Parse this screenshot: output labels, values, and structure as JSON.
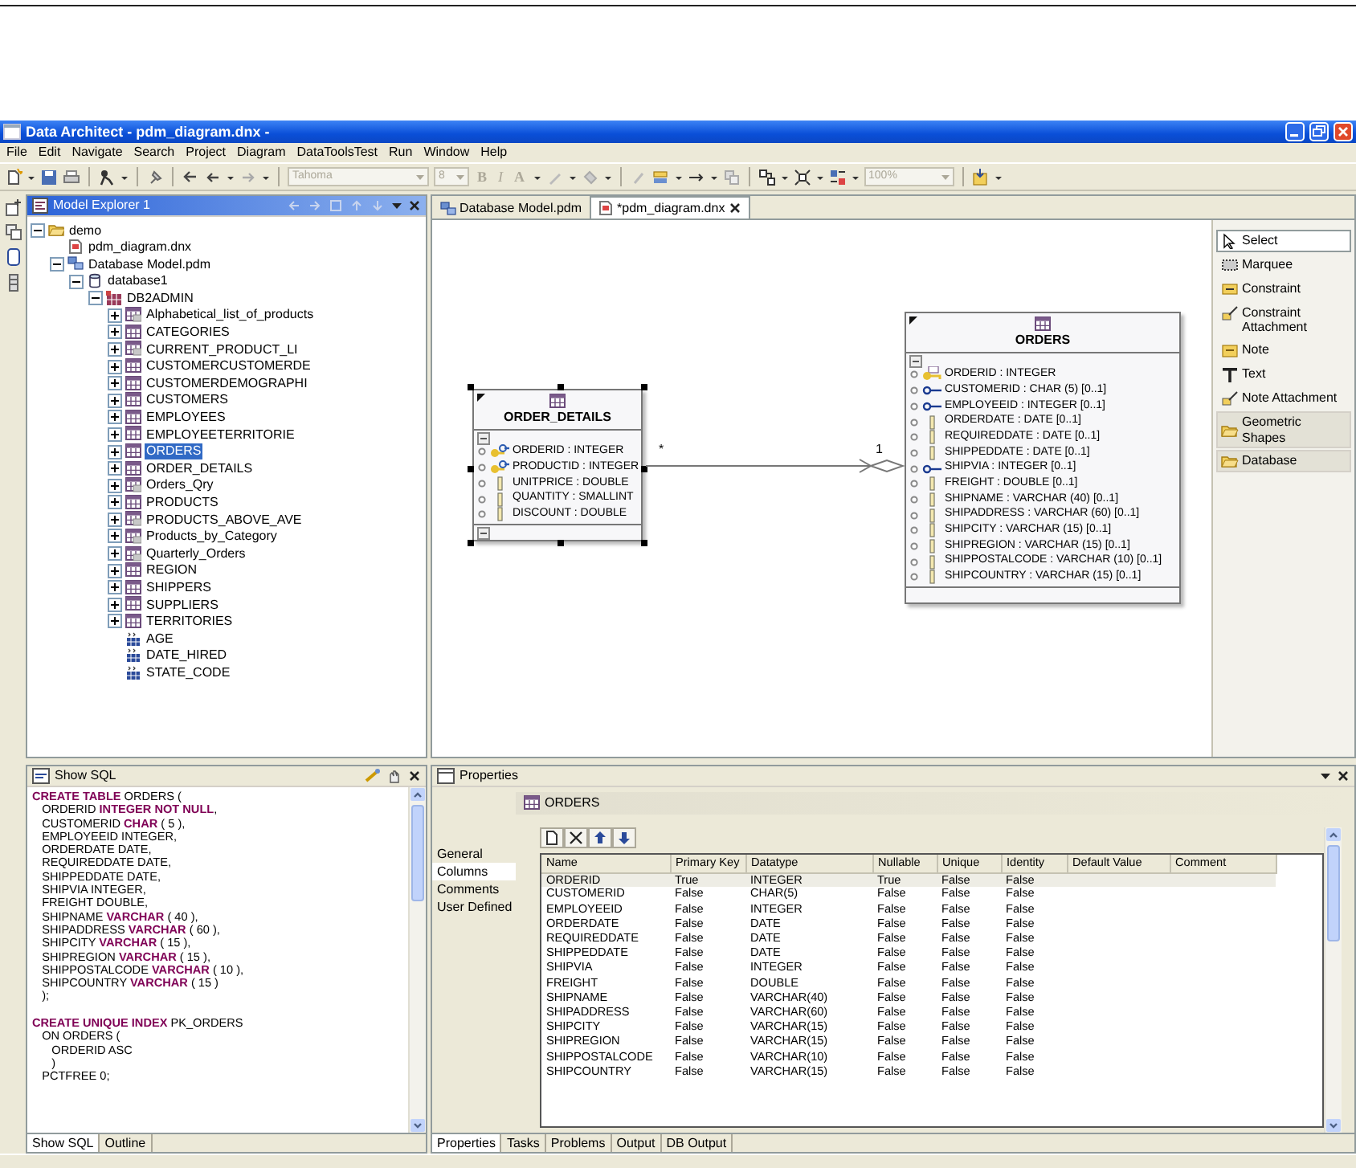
{
  "window": {
    "title": "Data Architect - pdm_diagram.dnx -"
  },
  "menu": [
    "File",
    "Edit",
    "Navigate",
    "Search",
    "Project",
    "Diagram",
    "DataToolsTest",
    "Run",
    "Window",
    "Help"
  ],
  "toolbar": {
    "font_field": {
      "value": "Tahoma",
      "disabled": true
    },
    "size_field": {
      "value": "8",
      "disabled": true
    },
    "glyph_buttons": [
      {
        "text": "B",
        "disabled": true
      },
      {
        "text": "I",
        "disabled": true
      },
      {
        "text": "A",
        "disabled": true
      }
    ],
    "zoom_field": {
      "value": "100%",
      "disabled": true
    }
  },
  "model_explorer": {
    "title": "Model Explorer 1",
    "tree": [
      {
        "label": "demo",
        "kind": "folder",
        "expanded": true,
        "selected": false,
        "children": [
          {
            "label": "pdm_diagram.dnx",
            "kind": "diagram",
            "selected": false
          },
          {
            "label": "Database Model.pdm",
            "kind": "model",
            "expanded": true,
            "selected": false,
            "children": [
              {
                "label": "database1",
                "kind": "database",
                "expanded": true,
                "selected": false,
                "children": [
                  {
                    "label": "DB2ADMIN",
                    "kind": "schema",
                    "expanded": true,
                    "selected": false,
                    "children": [
                      {
                        "label": "Alphabetical_list_of_products",
                        "kind": "view",
                        "expanded": false,
                        "selected": false
                      },
                      {
                        "label": "CATEGORIES",
                        "kind": "table",
                        "expanded": false,
                        "selected": false
                      },
                      {
                        "label": "CURRENT_PRODUCT_LI",
                        "kind": "view",
                        "expanded": false,
                        "selected": false
                      },
                      {
                        "label": "CUSTOMERCUSTOMERDE",
                        "kind": "table",
                        "expanded": false,
                        "selected": false
                      },
                      {
                        "label": "CUSTOMERDEMOGRAPHI",
                        "kind": "table",
                        "expanded": false,
                        "selected": false
                      },
                      {
                        "label": "CUSTOMERS",
                        "kind": "table",
                        "expanded": false,
                        "selected": false
                      },
                      {
                        "label": "EMPLOYEES",
                        "kind": "table",
                        "expanded": false,
                        "selected": false
                      },
                      {
                        "label": "EMPLOYEETERRITORIE",
                        "kind": "table",
                        "expanded": false,
                        "selected": false
                      },
                      {
                        "label": "ORDERS",
                        "kind": "table",
                        "expanded": false,
                        "selected": true
                      },
                      {
                        "label": "ORDER_DETAILS",
                        "kind": "table",
                        "expanded": false,
                        "selected": false
                      },
                      {
                        "label": "Orders_Qry",
                        "kind": "view",
                        "expanded": false,
                        "selected": false
                      },
                      {
                        "label": "PRODUCTS",
                        "kind": "table",
                        "expanded": false,
                        "selected": false
                      },
                      {
                        "label": "PRODUCTS_ABOVE_AVE",
                        "kind": "view",
                        "expanded": false,
                        "selected": false
                      },
                      {
                        "label": "Products_by_Category",
                        "kind": "view",
                        "expanded": false,
                        "selected": false
                      },
                      {
                        "label": "Quarterly_Orders",
                        "kind": "view",
                        "expanded": false,
                        "selected": false
                      },
                      {
                        "label": "REGION",
                        "kind": "table",
                        "expanded": false,
                        "selected": false
                      },
                      {
                        "label": "SHIPPERS",
                        "kind": "table",
                        "expanded": false,
                        "selected": false
                      },
                      {
                        "label": "SUPPLIERS",
                        "kind": "table",
                        "expanded": false,
                        "selected": false
                      },
                      {
                        "label": "TERRITORIES",
                        "kind": "table",
                        "expanded": false,
                        "selected": false
                      },
                      {
                        "label": "AGE",
                        "kind": "domain",
                        "selected": false
                      },
                      {
                        "label": "DATE_HIRED",
                        "kind": "domain",
                        "selected": false
                      },
                      {
                        "label": "STATE_CODE",
                        "kind": "domain",
                        "selected": false
                      }
                    ]
                  }
                ]
              }
            ]
          }
        ]
      }
    ]
  },
  "editor": {
    "tabs": [
      {
        "label": "Database Model.pdm",
        "selected": false
      },
      {
        "label": "*pdm_diagram.dnx",
        "selected": true
      }
    ],
    "diagram": {
      "tables": [
        {
          "name": "ORDER_DETAILS",
          "selected": true,
          "columns": [
            {
              "text": "ORDERID : INTEGER",
              "kind": "pk_fk"
            },
            {
              "text": "PRODUCTID : INTEGER",
              "kind": "pk_fk"
            },
            {
              "text": "UNITPRICE : DOUBLE",
              "kind": "column"
            },
            {
              "text": "QUANTITY : SMALLINT",
              "kind": "column"
            },
            {
              "text": "DISCOUNT : DOUBLE",
              "kind": "column"
            }
          ]
        },
        {
          "name": "ORDERS",
          "selected": false,
          "columns": [
            {
              "text": "ORDERID : INTEGER",
              "kind": "pk"
            },
            {
              "text": "CUSTOMERID : CHAR (5) [0..1]",
              "kind": "fk"
            },
            {
              "text": "EMPLOYEEID : INTEGER [0..1]",
              "kind": "fk"
            },
            {
              "text": "ORDERDATE : DATE [0..1]",
              "kind": "column"
            },
            {
              "text": "REQUIREDDATE : DATE [0..1]",
              "kind": "column"
            },
            {
              "text": "SHIPPEDDATE : DATE [0..1]",
              "kind": "column"
            },
            {
              "text": "SHIPVIA : INTEGER [0..1]",
              "kind": "fk"
            },
            {
              "text": "FREIGHT : DOUBLE [0..1]",
              "kind": "column"
            },
            {
              "text": "SHIPNAME : VARCHAR (40) [0..1]",
              "kind": "column"
            },
            {
              "text": "SHIPADDRESS : VARCHAR (60) [0..1]",
              "kind": "column"
            },
            {
              "text": "SHIPCITY : VARCHAR (15) [0..1]",
              "kind": "column"
            },
            {
              "text": "SHIPREGION : VARCHAR (15) [0..1]",
              "kind": "column"
            },
            {
              "text": "SHIPPOSTALCODE : VARCHAR (10) [0..1]",
              "kind": "column"
            },
            {
              "text": "SHIPCOUNTRY : VARCHAR (15) [0..1]",
              "kind": "column"
            }
          ]
        }
      ],
      "relationship": {
        "from_label": "*",
        "to_label": "1"
      }
    },
    "palette": [
      {
        "label": "Select",
        "kind": "select",
        "selected": true
      },
      {
        "label": "Marquee",
        "kind": "marquee",
        "selected": false
      },
      {
        "label": "Constraint",
        "kind": "constraint",
        "selected": false
      },
      {
        "label": "Constraint Attachment",
        "kind": "attachment",
        "selected": false
      },
      {
        "label": "Note",
        "kind": "note",
        "selected": false
      },
      {
        "label": "Text",
        "kind": "text",
        "selected": false
      },
      {
        "label": "Note Attachment",
        "kind": "attachment",
        "selected": false
      },
      {
        "label": "Geometric Shapes",
        "kind": "drawer"
      },
      {
        "label": "Database",
        "kind": "drawer"
      }
    ]
  },
  "show_sql": {
    "title": "Show SQL",
    "statements": [
      [
        "**CREATE TABLE** ORDERS (",
        "   ORDERID **INTEGER NOT NULL**,",
        "   CUSTOMERID **CHAR** ( 5 ),",
        "   EMPLOYEEID INTEGER,",
        "   ORDERDATE DATE,",
        "   REQUIREDDATE DATE,",
        "   SHIPPEDDATE DATE,",
        "   SHIPVIA INTEGER,",
        "   FREIGHT DOUBLE,",
        "   SHIPNAME **VARCHAR** ( 40 ),",
        "   SHIPADDRESS **VARCHAR** ( 60 ),",
        "   SHIPCITY **VARCHAR** ( 15 ),",
        "   SHIPREGION **VARCHAR** ( 15 ),",
        "   SHIPPOSTALCODE **VARCHAR** ( 10 ),",
        "   SHIPCOUNTRY **VARCHAR** ( 15 )",
        "   );"
      ],
      [
        "**CREATE UNIQUE INDEX** PK_ORDERS",
        "   ON ORDERS (",
        "      ORDERID ASC",
        "      )",
        "   PCTFREE 0;"
      ]
    ],
    "tabs": [
      {
        "label": "Show SQL",
        "selected": true
      },
      {
        "label": "Outline",
        "selected": false
      }
    ]
  },
  "properties": {
    "title": "Properties",
    "object": "ORDERS",
    "sections": [
      {
        "label": "General",
        "selected": false
      },
      {
        "label": "Columns",
        "selected": true
      },
      {
        "label": "Comments",
        "selected": false
      },
      {
        "label": "User Defined",
        "selected": false
      }
    ],
    "table": {
      "columns": [
        "Name",
        "Primary Key",
        "Datatype",
        "Nullable",
        "Unique",
        "Identity",
        "Default Value",
        "Comment"
      ],
      "rows": [
        {
          "selected": true,
          "cells": [
            "ORDERID",
            "True",
            "INTEGER",
            "True",
            "False",
            "False"
          ]
        },
        {
          "selected": false,
          "cells": [
            "CUSTOMERID",
            "False",
            "CHAR(5)",
            "False",
            "False",
            "False"
          ]
        },
        {
          "selected": false,
          "cells": [
            "EMPLOYEEID",
            "False",
            "INTEGER",
            "False",
            "False",
            "False"
          ]
        },
        {
          "selected": false,
          "cells": [
            "ORDERDATE",
            "False",
            "DATE",
            "False",
            "False",
            "False"
          ]
        },
        {
          "selected": false,
          "cells": [
            "REQUIREDDATE",
            "False",
            "DATE",
            "False",
            "False",
            "False"
          ]
        },
        {
          "selected": false,
          "cells": [
            "SHIPPEDDATE",
            "False",
            "DATE",
            "False",
            "False",
            "False"
          ]
        },
        {
          "selected": false,
          "cells": [
            "SHIPVIA",
            "False",
            "INTEGER",
            "False",
            "False",
            "False"
          ]
        },
        {
          "selected": false,
          "cells": [
            "FREIGHT",
            "False",
            "DOUBLE",
            "False",
            "False",
            "False"
          ]
        },
        {
          "selected": false,
          "cells": [
            "SHIPNAME",
            "False",
            "VARCHAR(40)",
            "False",
            "False",
            "False"
          ]
        },
        {
          "selected": false,
          "cells": [
            "SHIPADDRESS",
            "False",
            "VARCHAR(60)",
            "False",
            "False",
            "False"
          ]
        },
        {
          "selected": false,
          "cells": [
            "SHIPCITY",
            "False",
            "VARCHAR(15)",
            "False",
            "False",
            "False"
          ]
        },
        {
          "selected": false,
          "cells": [
            "SHIPREGION",
            "False",
            "VARCHAR(15)",
            "False",
            "False",
            "False"
          ]
        },
        {
          "selected": false,
          "cells": [
            "SHIPPOSTALCODE",
            "False",
            "VARCHAR(10)",
            "False",
            "False",
            "False"
          ]
        },
        {
          "selected": false,
          "cells": [
            "SHIPCOUNTRY",
            "False",
            "VARCHAR(15)",
            "False",
            "False",
            "False"
          ]
        }
      ]
    },
    "tabs": [
      {
        "label": "Properties",
        "selected": true
      },
      {
        "label": "Tasks",
        "selected": false
      },
      {
        "label": "Problems",
        "selected": false
      },
      {
        "label": "Output",
        "selected": false
      },
      {
        "label": "DB Output",
        "selected": false
      }
    ]
  }
}
